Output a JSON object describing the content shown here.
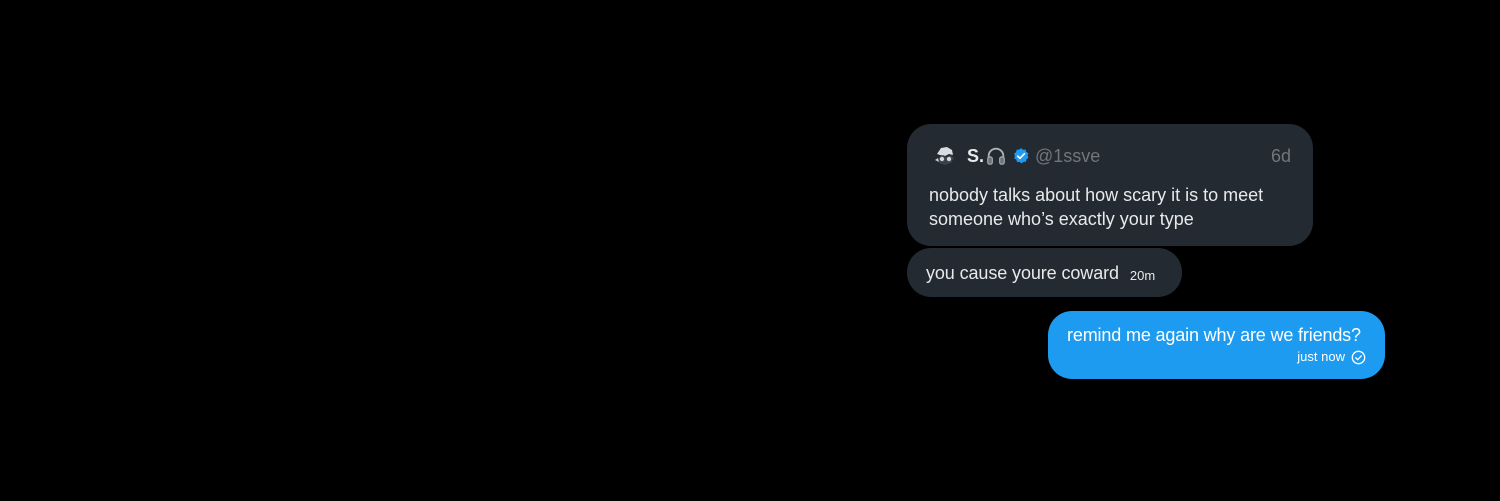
{
  "conversation": {
    "quoted_post": {
      "display_name": "S.",
      "badge_icon": "headphones-icon",
      "verified_icon": "verified-badge-icon",
      "handle": "@1ssve",
      "age": "6d",
      "text": "nobody talks about how scary it is to meet someone who’s exactly your type"
    },
    "reply": {
      "text": "you cause youre coward",
      "time": "20m"
    },
    "sent_message": {
      "text": "remind me again why are we friends?",
      "time": "just now",
      "status_icon": "check-circle-icon"
    }
  },
  "colors": {
    "background": "#000000",
    "received_bubble": "#232a31",
    "sent_bubble": "#1d9bf0",
    "verified": "#1d9bf0",
    "secondary_text": "#71767b"
  }
}
